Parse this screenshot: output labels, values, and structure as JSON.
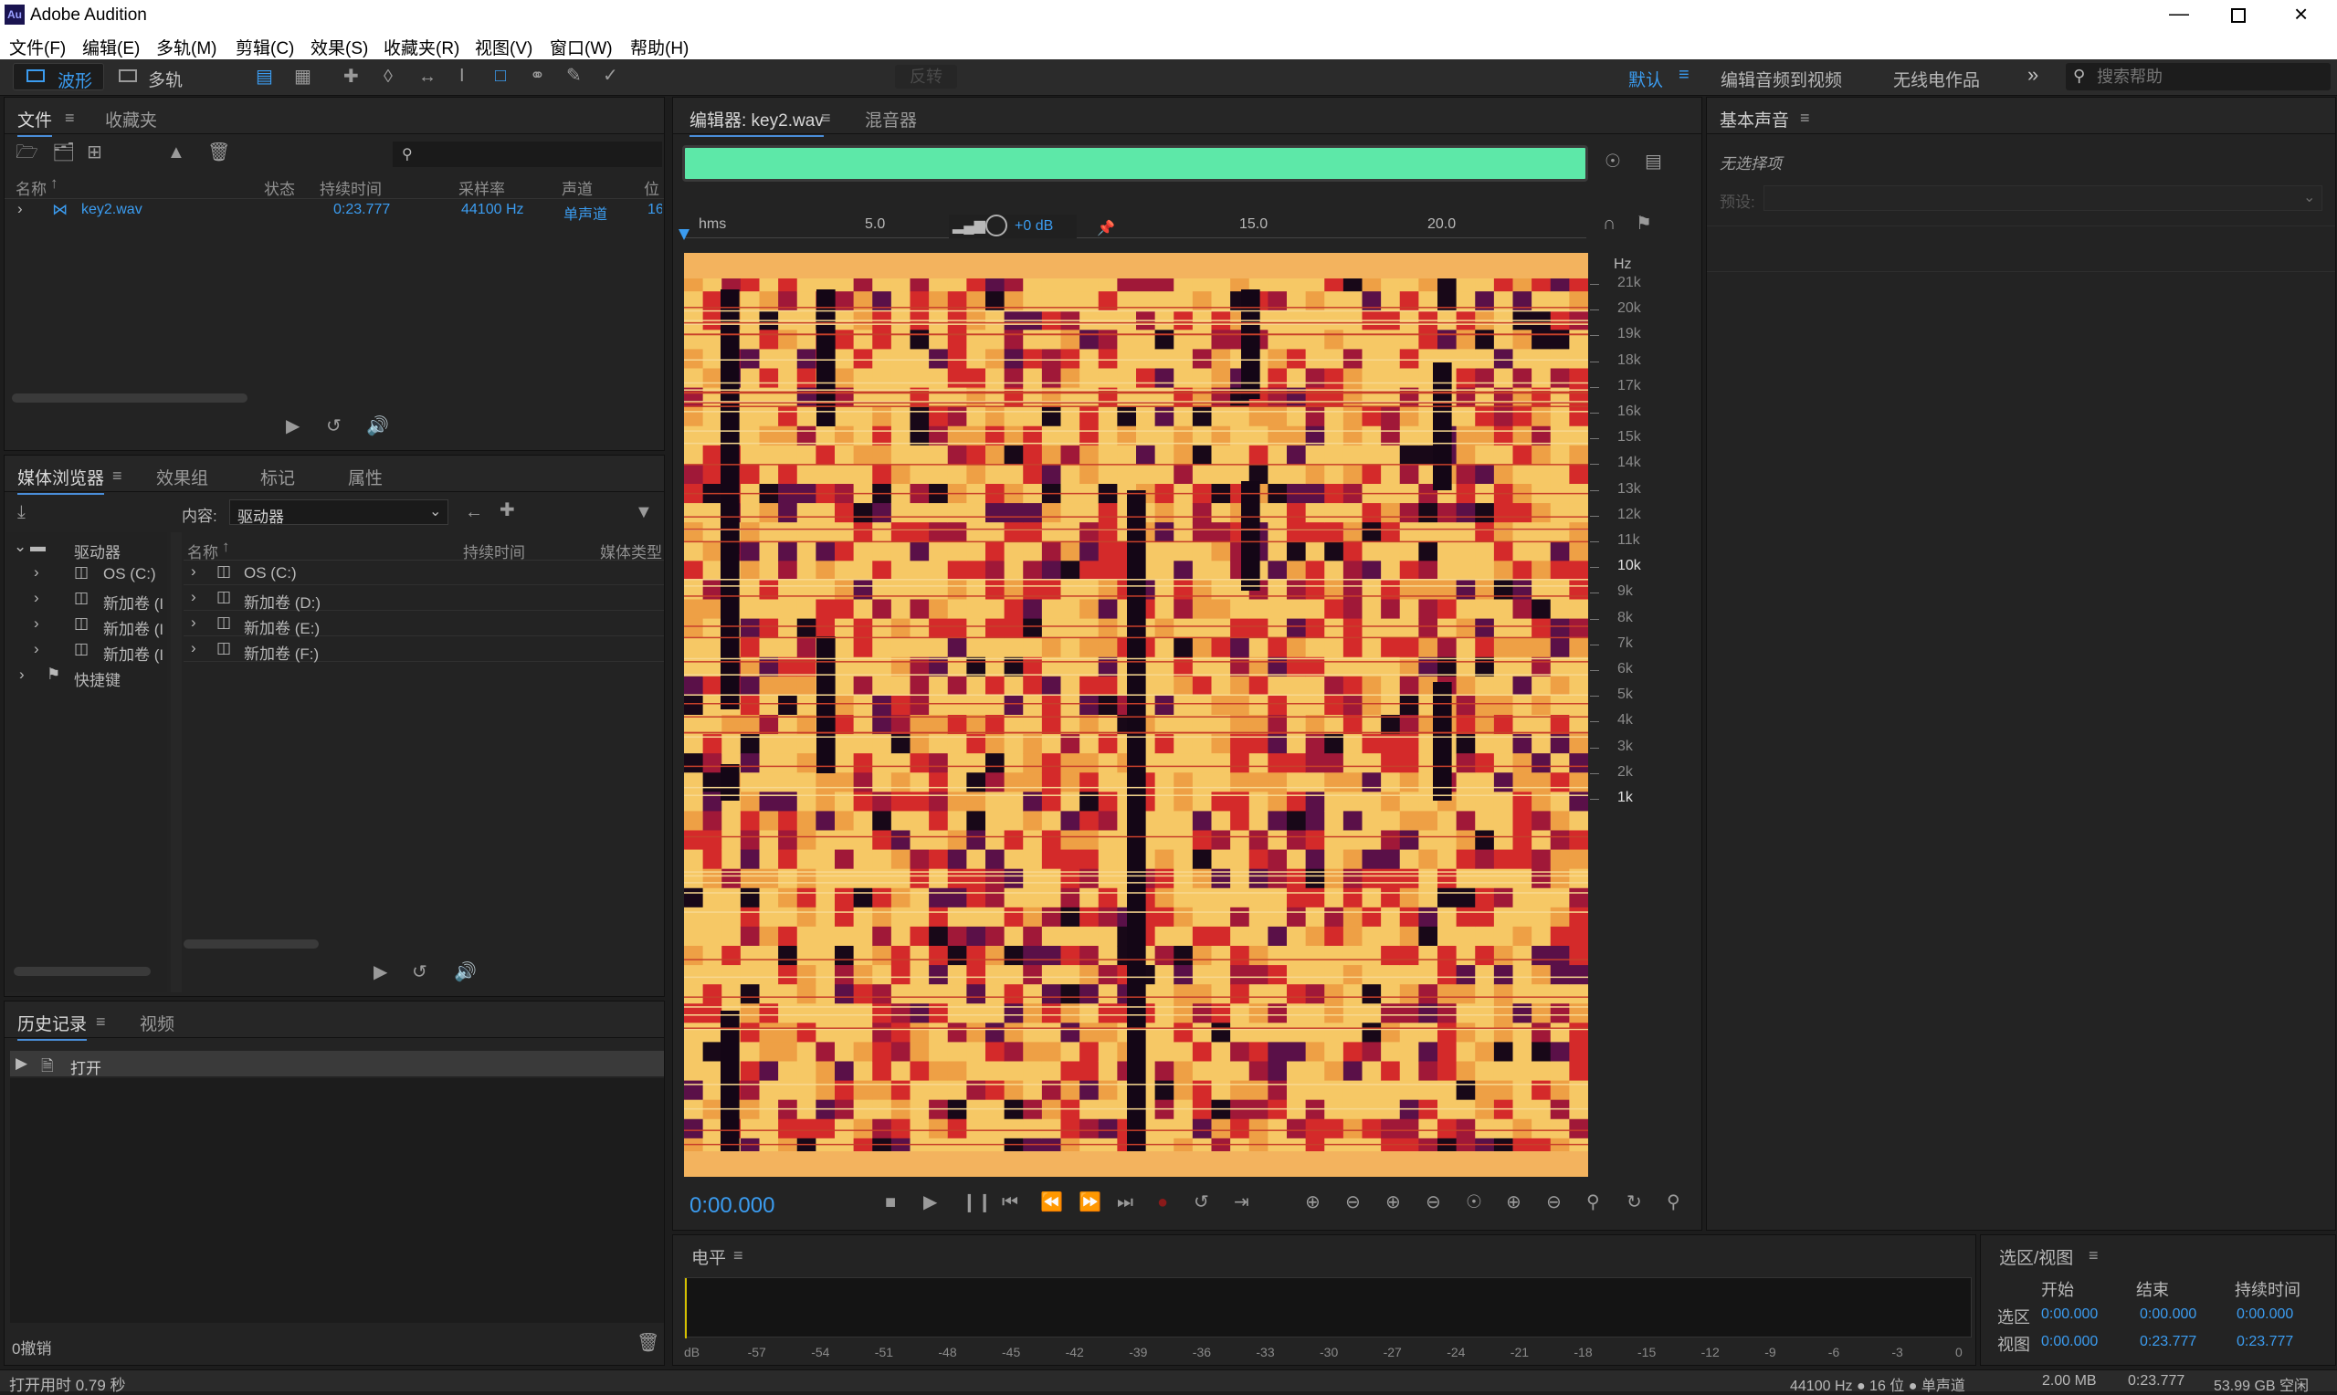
{
  "app": {
    "title": "Adobe Audition",
    "icon_text": "Au"
  },
  "menu": [
    "文件(F)",
    "编辑(E)",
    "多轨(M)",
    "剪辑(C)",
    "效果(S)",
    "收藏夹(R)",
    "视图(V)",
    "窗口(W)",
    "帮助(H)"
  ],
  "toolbar": {
    "waveform": "波形",
    "multitrack": "多轨",
    "invert": "反转",
    "workspace_default": "默认",
    "workspace_edit_video": "编辑音频到视频",
    "workspace_radio": "无线电作品",
    "search_placeholder": "搜索帮助"
  },
  "files_panel": {
    "tabs": [
      "文件",
      "收藏夹"
    ],
    "columns": [
      "名称",
      "状态",
      "持续时间",
      "采样率",
      "声道",
      "位"
    ],
    "rows": [
      {
        "name": "key2.wav",
        "duration": "0:23.777",
        "rate": "44100 Hz",
        "channels": "单声道",
        "bits": "16"
      }
    ]
  },
  "media_browser": {
    "tabs": [
      "媒体浏览器",
      "效果组",
      "标记",
      "属性"
    ],
    "content_label": "内容:",
    "content_value": "驱动器",
    "tree": [
      {
        "label": "驱动器",
        "level": 0
      },
      {
        "label": "OS (C:)",
        "level": 1
      },
      {
        "label": "新加卷 (I",
        "level": 1
      },
      {
        "label": "新加卷 (I",
        "level": 1
      },
      {
        "label": "新加卷 (I",
        "level": 1
      },
      {
        "label": "快捷键",
        "level": 0
      }
    ],
    "columns": [
      "名称",
      "持续时间",
      "媒体类型"
    ],
    "list": [
      "OS (C:)",
      "新加卷 (D:)",
      "新加卷 (E:)",
      "新加卷 (F:)"
    ]
  },
  "history": {
    "tabs": [
      "历史记录",
      "视频"
    ],
    "items": [
      "打开"
    ],
    "undo": "0撤销"
  },
  "status": {
    "open_time": "打开用时 0.79 秒",
    "format": "44100 Hz ● 16 位 ● 单声道",
    "size": "2.00 MB",
    "duration": "0:23.777",
    "free": "53.99 GB 空闲"
  },
  "editor": {
    "tabs": [
      "编辑器: key2.wav",
      "混音器"
    ],
    "ruler_unit": "hms",
    "ruler": [
      "5.0",
      "15.0",
      "20.0"
    ],
    "gain": "+0 dB",
    "freq_unit": "Hz",
    "freq_labels": [
      "21k",
      "20k",
      "19k",
      "18k",
      "17k",
      "16k",
      "15k",
      "14k",
      "13k",
      "12k",
      "11k",
      "10k",
      "9k",
      "8k",
      "7k",
      "6k",
      "5k",
      "4k",
      "3k",
      "2k",
      "1k"
    ],
    "time": "0:00.000"
  },
  "levels": {
    "title": "电平",
    "scale": [
      "dB",
      "-57",
      "-54",
      "-51",
      "-48",
      "-45",
      "-42",
      "-39",
      "-36",
      "-33",
      "-30",
      "-27",
      "-24",
      "-21",
      "-18",
      "-15",
      "-12",
      "-9",
      "-6",
      "-3",
      "0"
    ]
  },
  "essential_sound": {
    "title": "基本声音",
    "no_selection": "无选择项",
    "preset_label": "预设:"
  },
  "selection_view": {
    "title": "选区/视图",
    "headers": [
      "开始",
      "结束",
      "持续时间"
    ],
    "rows": [
      {
        "label": "选区",
        "start": "0:00.000",
        "end": "0:00.000",
        "dur": "0:00.000"
      },
      {
        "label": "视图",
        "start": "0:00.000",
        "end": "0:23.777",
        "dur": "0:23.777"
      }
    ]
  },
  "colors": {
    "accent": "#3b9cf0",
    "overview": "#5de8a8",
    "spec_hot": "#f5c060",
    "spec_mid": "#d42a2a",
    "spec_cold": "#1a0a1a"
  }
}
